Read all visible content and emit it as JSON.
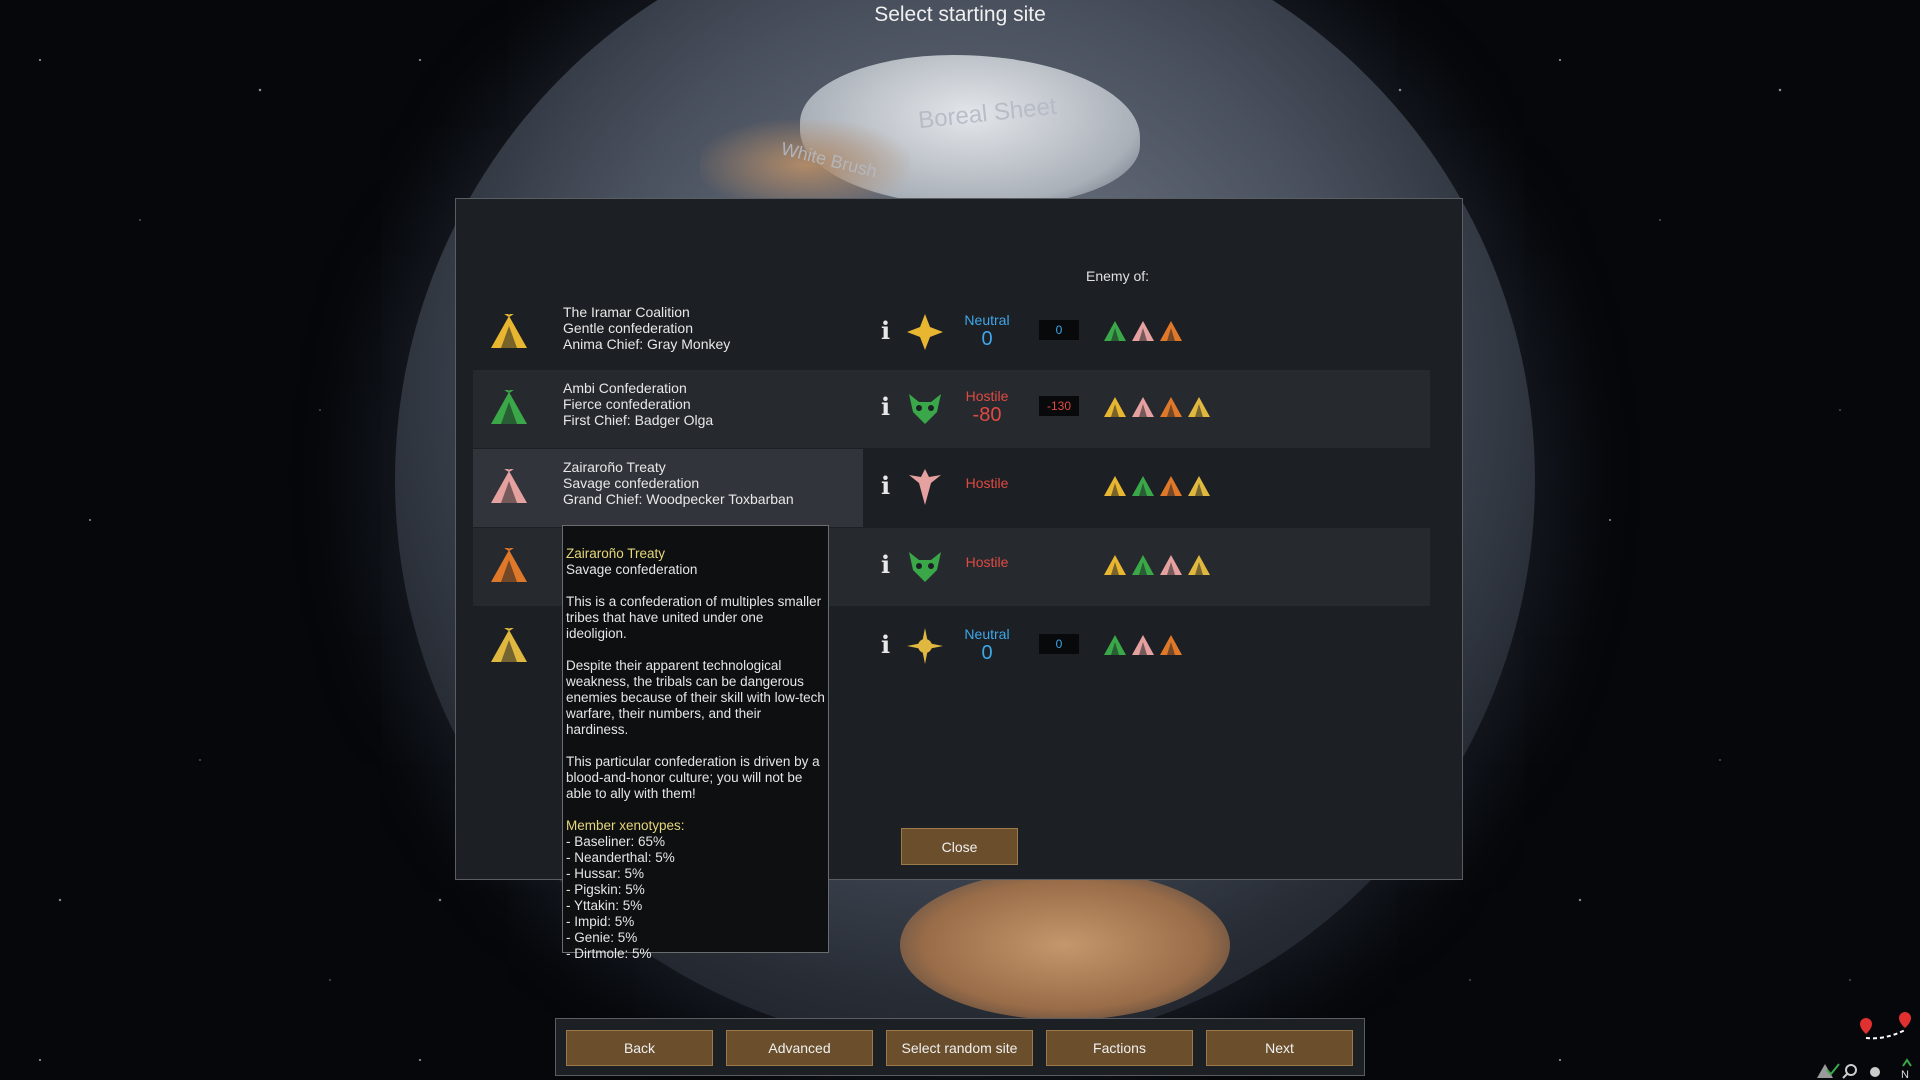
{
  "screen_title": "Select starting site",
  "map_labels": {
    "ice": "Boreal Sheet",
    "brush": "White Brush"
  },
  "enemy_header": "Enemy of:",
  "colors": {
    "gold": "#e8b630",
    "green": "#3aa848",
    "pink": "#e5a0a0",
    "orange": "#e0782a",
    "yellow": "#e0b840",
    "neutral": "#3ea7ea",
    "hostile": "#e04a42",
    "button": "#6b4f2c"
  },
  "factions": [
    {
      "name": "The Iramar Coalition",
      "kind": "Gentle confederation",
      "leader": "Anima Chief: Gray Monkey",
      "icon": "tribe-tent-gold-icon",
      "ideology_icon": "star-burst-ideology-icon",
      "relation": "Neutral",
      "relation_value": "0",
      "goodwill": "0",
      "enemies": [
        "green",
        "pink",
        "orange"
      ]
    },
    {
      "name": "Ambi Confederation",
      "kind": "Fierce confederation",
      "leader": "First Chief: Badger Olga",
      "icon": "tribe-tent-green-icon",
      "ideology_icon": "horned-mask-ideology-icon",
      "relation": "Hostile",
      "relation_value": "-80",
      "goodwill": "-130",
      "enemies": [
        "gold",
        "pink",
        "orange",
        "yellow"
      ]
    },
    {
      "name": "Zairaroño Treaty",
      "kind": "Savage confederation",
      "leader": "Grand Chief: Woodpecker Toxbarban",
      "icon": "tribe-tent-pink-icon",
      "ideology_icon": "winged-blade-ideology-icon",
      "relation": "Hostile",
      "relation_value": "",
      "goodwill": "",
      "enemies": [
        "gold",
        "green",
        "orange",
        "yellow"
      ]
    },
    {
      "name": "",
      "kind": "",
      "leader": "",
      "icon": "tribe-tent-orange-icon",
      "ideology_icon": "horned-mask-ideology-icon",
      "relation": "Hostile",
      "relation_value": "",
      "goodwill": "",
      "enemies": [
        "gold",
        "green",
        "pink",
        "yellow"
      ]
    },
    {
      "name": "",
      "kind": "",
      "leader": "",
      "icon": "tribe-tent-yellow-icon",
      "ideology_icon": "compass-star-ideology-icon",
      "relation": "Neutral",
      "relation_value": "0",
      "goodwill": "0",
      "enemies": [
        "green",
        "pink",
        "orange"
      ]
    }
  ],
  "tooltip": {
    "title": "Zairaroño Treaty",
    "subtitle": "Savage confederation",
    "paragraph1": "This is a confederation of multiples smaller tribes that have united under one ideoligion.",
    "paragraph2": "Despite their apparent technological weakness, the tribals can be dangerous enemies because of their skill with low-tech warfare, their numbers, and their hardiness.",
    "paragraph3": "This particular confederation is driven by a blood-and-honor culture; you will not be able to ally with them!",
    "xeno_header": "Member xenotypes:",
    "xenotypes": [
      " - Baseliner: 65%",
      " - Neanderthal: 5%",
      " - Hussar: 5%",
      " - Pigskin: 5%",
      " - Yttakin: 5%",
      " - Impid: 5%",
      " - Genie: 5%",
      " - Dirtmole: 5%"
    ]
  },
  "close_label": "Close",
  "bottom_buttons": [
    "Back",
    "Advanced",
    "Select random site",
    "Factions",
    "Next"
  ]
}
